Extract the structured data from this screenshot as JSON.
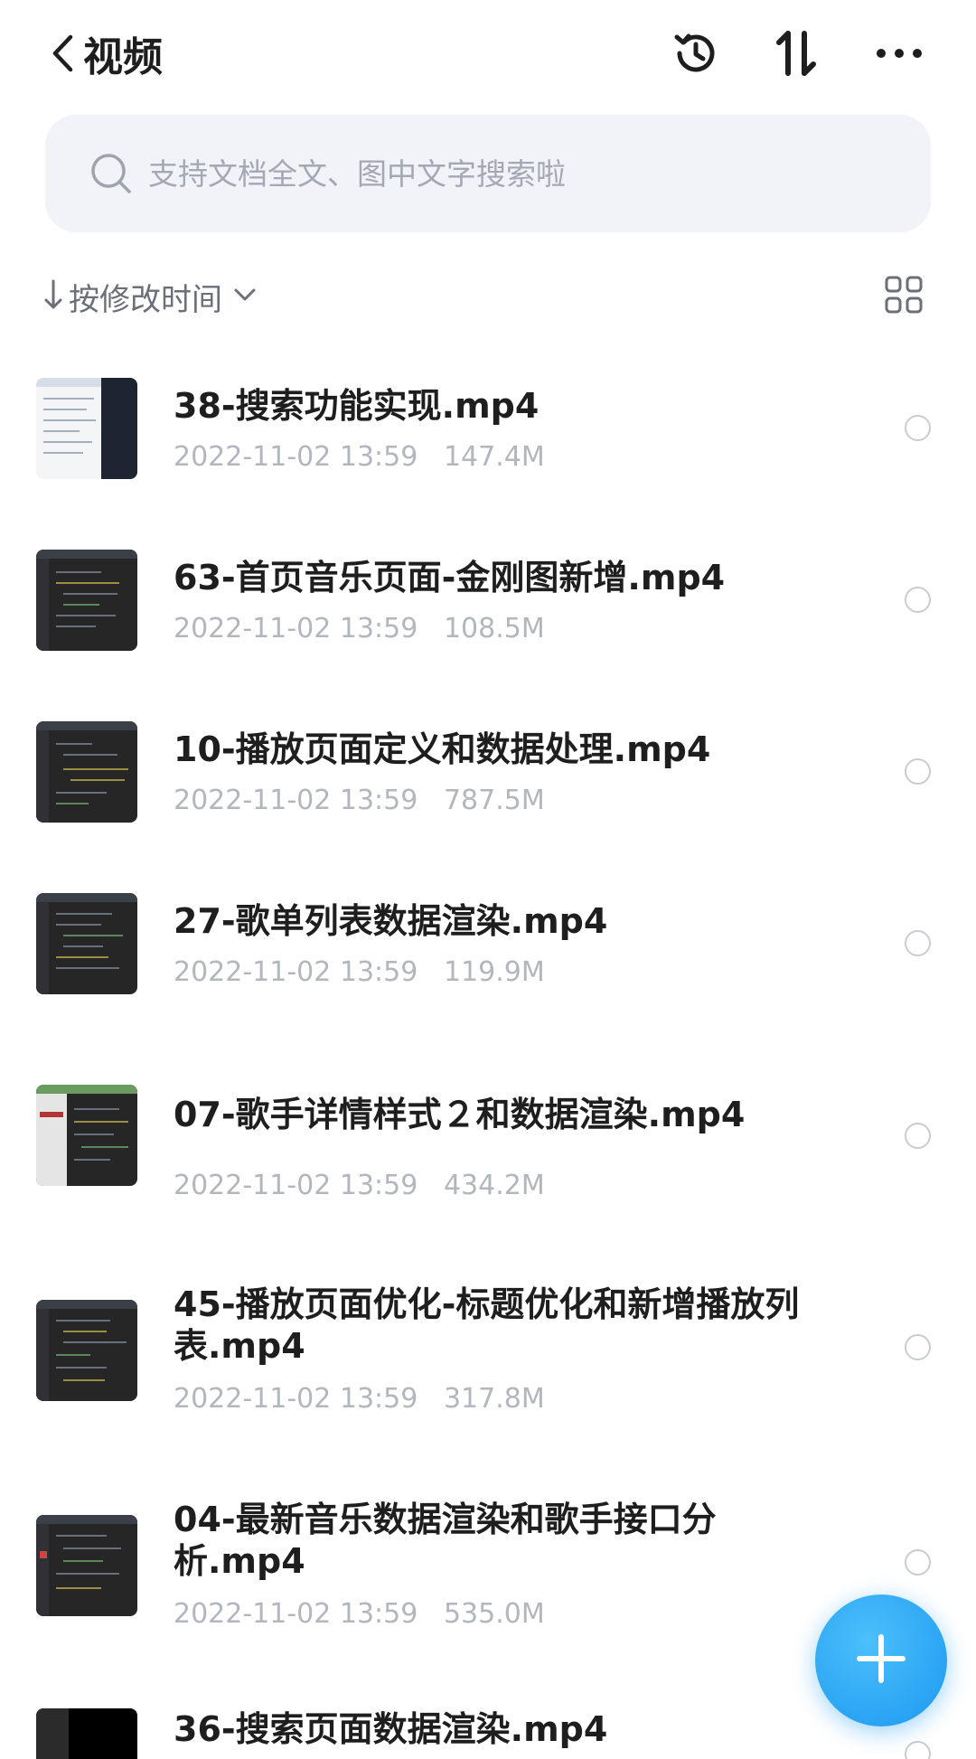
{
  "header": {
    "title": "视频",
    "icons": [
      "history-icon",
      "sort-toggle-icon",
      "more-icon"
    ]
  },
  "search": {
    "placeholder": "支持文档全文、图中文字搜索啦"
  },
  "sort": {
    "label": "按修改时间"
  },
  "files": [
    {
      "name": "38-搜索功能实现.mp4",
      "date": "2022-11-02 13:59",
      "size": "147.4M"
    },
    {
      "name": "63-首页音乐页面-金刚图新增.mp4",
      "date": "2022-11-02 13:59",
      "size": "108.5M"
    },
    {
      "name": "10-播放页面定义和数据处理.mp4",
      "date": "2022-11-02 13:59",
      "size": "787.5M"
    },
    {
      "name": "27-歌单列表数据渲染.mp4",
      "date": "2022-11-02 13:59",
      "size": "119.9M"
    },
    {
      "name": "07-歌手详情样式２和数据渲染.mp4",
      "date": "2022-11-02 13:59",
      "size": "434.2M"
    },
    {
      "name": "45-播放页面优化-标题优化和新增播放列表.mp4",
      "date": "2022-11-02 13:59",
      "size": "317.8M"
    },
    {
      "name": "04-最新音乐数据渲染和歌手接口分析.mp4",
      "date": "2022-11-02 13:59",
      "size": "535.0M"
    },
    {
      "name": "36-搜索页面数据渲染.mp4",
      "date": "",
      "size": ""
    }
  ],
  "colors": {
    "accent": "#2aa4f4",
    "search_bg": "#f1f3f9",
    "meta_text": "#b2b6bd"
  }
}
